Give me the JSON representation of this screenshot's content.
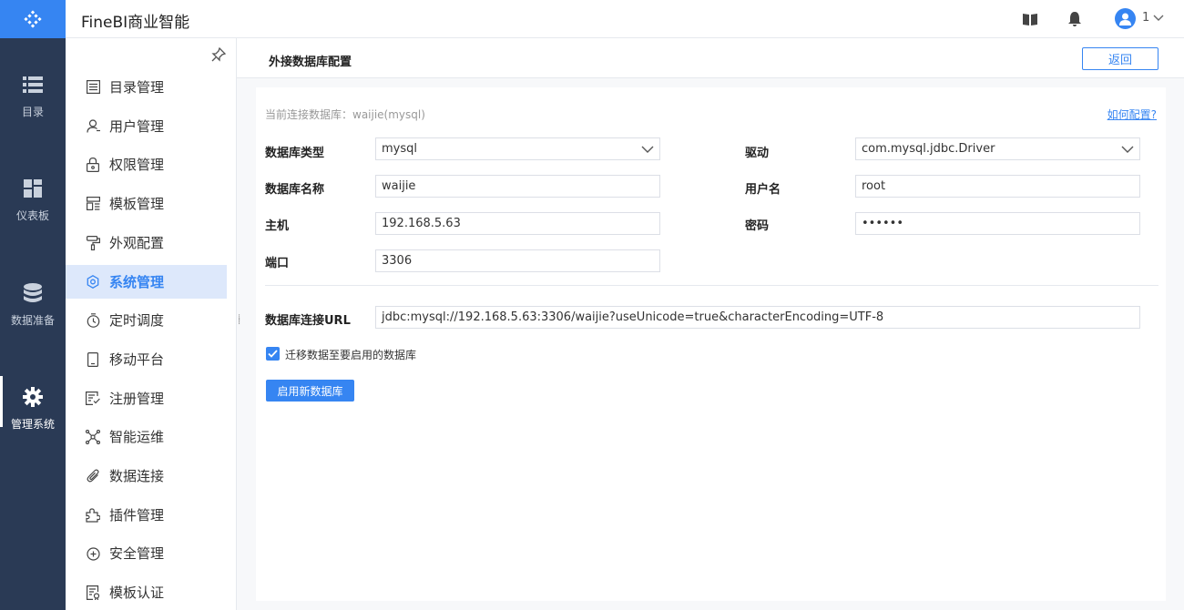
{
  "app": {
    "title": "FineBI商业智能"
  },
  "rail": {
    "items": [
      {
        "label": "目录",
        "icon": "list-icon"
      },
      {
        "label": "仪表板",
        "icon": "dashboard-icon"
      },
      {
        "label": "数据准备",
        "icon": "database-icon"
      },
      {
        "label": "管理系统",
        "icon": "gear-icon",
        "active": true
      }
    ]
  },
  "header": {
    "user_name": "1"
  },
  "subnav": {
    "items": [
      {
        "label": "目录管理"
      },
      {
        "label": "用户管理"
      },
      {
        "label": "权限管理"
      },
      {
        "label": "模板管理"
      },
      {
        "label": "外观配置"
      },
      {
        "label": "系统管理",
        "active": true
      },
      {
        "label": "定时调度"
      },
      {
        "label": "移动平台"
      },
      {
        "label": "注册管理"
      },
      {
        "label": "智能运维"
      },
      {
        "label": "数据连接"
      },
      {
        "label": "插件管理"
      },
      {
        "label": "安全管理"
      },
      {
        "label": "模板认证"
      }
    ]
  },
  "page": {
    "title": "外接数据库配置",
    "back_label": "返回"
  },
  "form": {
    "current_db": "当前连接数据库：waijie(mysql)",
    "howto": "如何配置?",
    "db_type_label": "数据库类型",
    "db_type_value": "mysql",
    "driver_label": "驱动",
    "driver_value": "com.mysql.jdbc.Driver",
    "db_name_label": "数据库名称",
    "db_name_value": "waijie",
    "username_label": "用户名",
    "username_value": "root",
    "host_label": "主机",
    "host_value": "192.168.5.63",
    "password_label": "密码",
    "password_value": "••••••",
    "port_label": "端口",
    "port_value": "3306",
    "url_label": "数据库连接URL",
    "url_value": "jdbc:mysql://192.168.5.63:3306/waijie?useUnicode=true&characterEncoding=UTF-8",
    "migrate_label": "迁移数据至要启用的数据库",
    "migrate_checked": true,
    "enable_button": "启用新数据库"
  },
  "colors": {
    "accent": "#3685f2",
    "rail_bg": "#2a3a55",
    "active_nav_bg": "#dde8fb"
  }
}
